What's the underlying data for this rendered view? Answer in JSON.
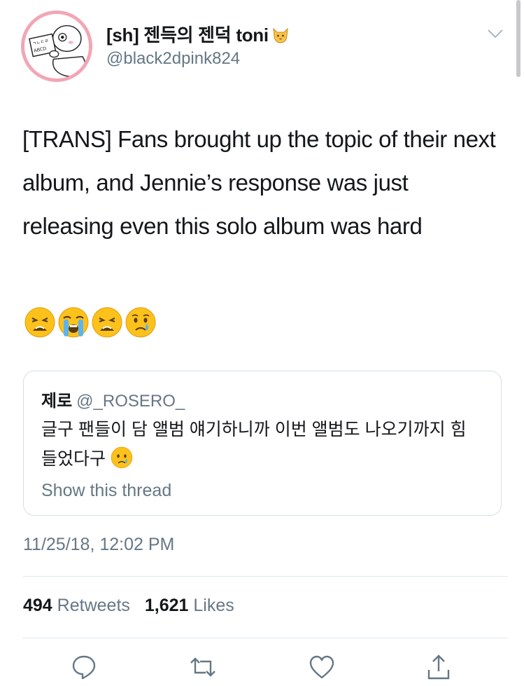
{
  "author": {
    "display_name": "[sh] 젠득의 젠덕 toni",
    "handle": "@black2dpink824",
    "avatar_icon": "cartoon-character-holding-sign-icon",
    "avatar_sign_text": "ㄱㄴㄷㄹ ABCD",
    "name_emoji_icon": "cat-face-icon"
  },
  "tweet": {
    "text": "[TRANS] Fans brought up the topic of their next album, and Jennie’s response was just releasing even this solo album was hard",
    "emojis": [
      "weary-face-icon",
      "loudly-crying-face-icon",
      "weary-face-icon",
      "crying-face-icon"
    ]
  },
  "quoted_tweet": {
    "name": "제로",
    "handle": "@_ROSERO_",
    "text": "글구 팬들이 담 앨범 얘기하니까 이번 앨범도 나오기까지 힘들었다구",
    "emoji": "crying-face-icon",
    "show_thread_label": "Show this thread"
  },
  "timestamp": "11/25/18, 12:02 PM",
  "stats": {
    "retweets_count": "494",
    "retweets_label": "Retweets",
    "likes_count": "1,621",
    "likes_label": "Likes"
  },
  "actions": [
    "reply-icon",
    "retweet-icon",
    "like-icon",
    "share-icon"
  ],
  "colors": {
    "text": "#14171a",
    "secondary": "#657786",
    "border": "#d6dee4",
    "avatar_ring": "#f2a6b5",
    "icon": "#657786"
  }
}
